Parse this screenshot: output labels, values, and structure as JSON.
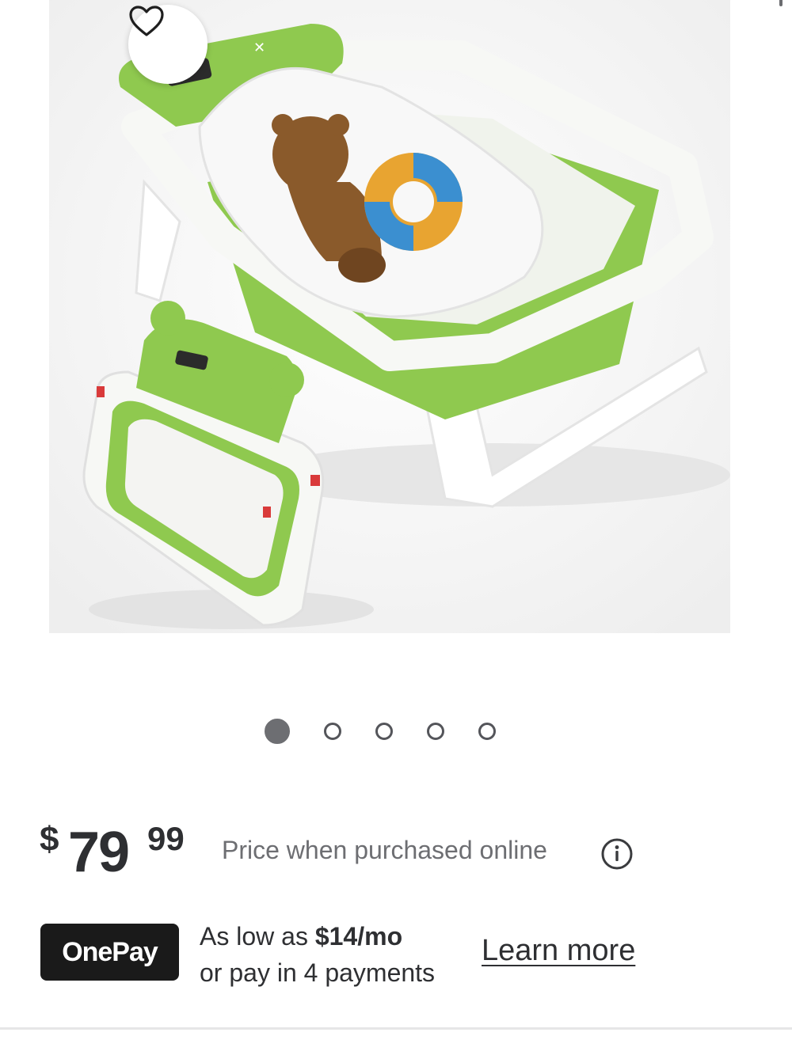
{
  "product_image": {
    "alt_icon": "baby-bathtub-image",
    "colors": {
      "tub_green": "#8fc94f",
      "tub_white": "#f7f8f5",
      "bear_brown": "#8a5a2b"
    }
  },
  "favorite": {
    "icon": "heart-icon"
  },
  "carousel": {
    "count": 5,
    "active_index": 0
  },
  "price": {
    "currency": "$",
    "dollars": "79",
    "cents": "99",
    "note": "Price when purchased online",
    "info_icon": "info-icon"
  },
  "onepay": {
    "badge": "OnePay",
    "line1_prefix": "As low as ",
    "line1_amount": "$14/mo",
    "line2": "or pay in 4 payments",
    "link": "Learn more"
  }
}
